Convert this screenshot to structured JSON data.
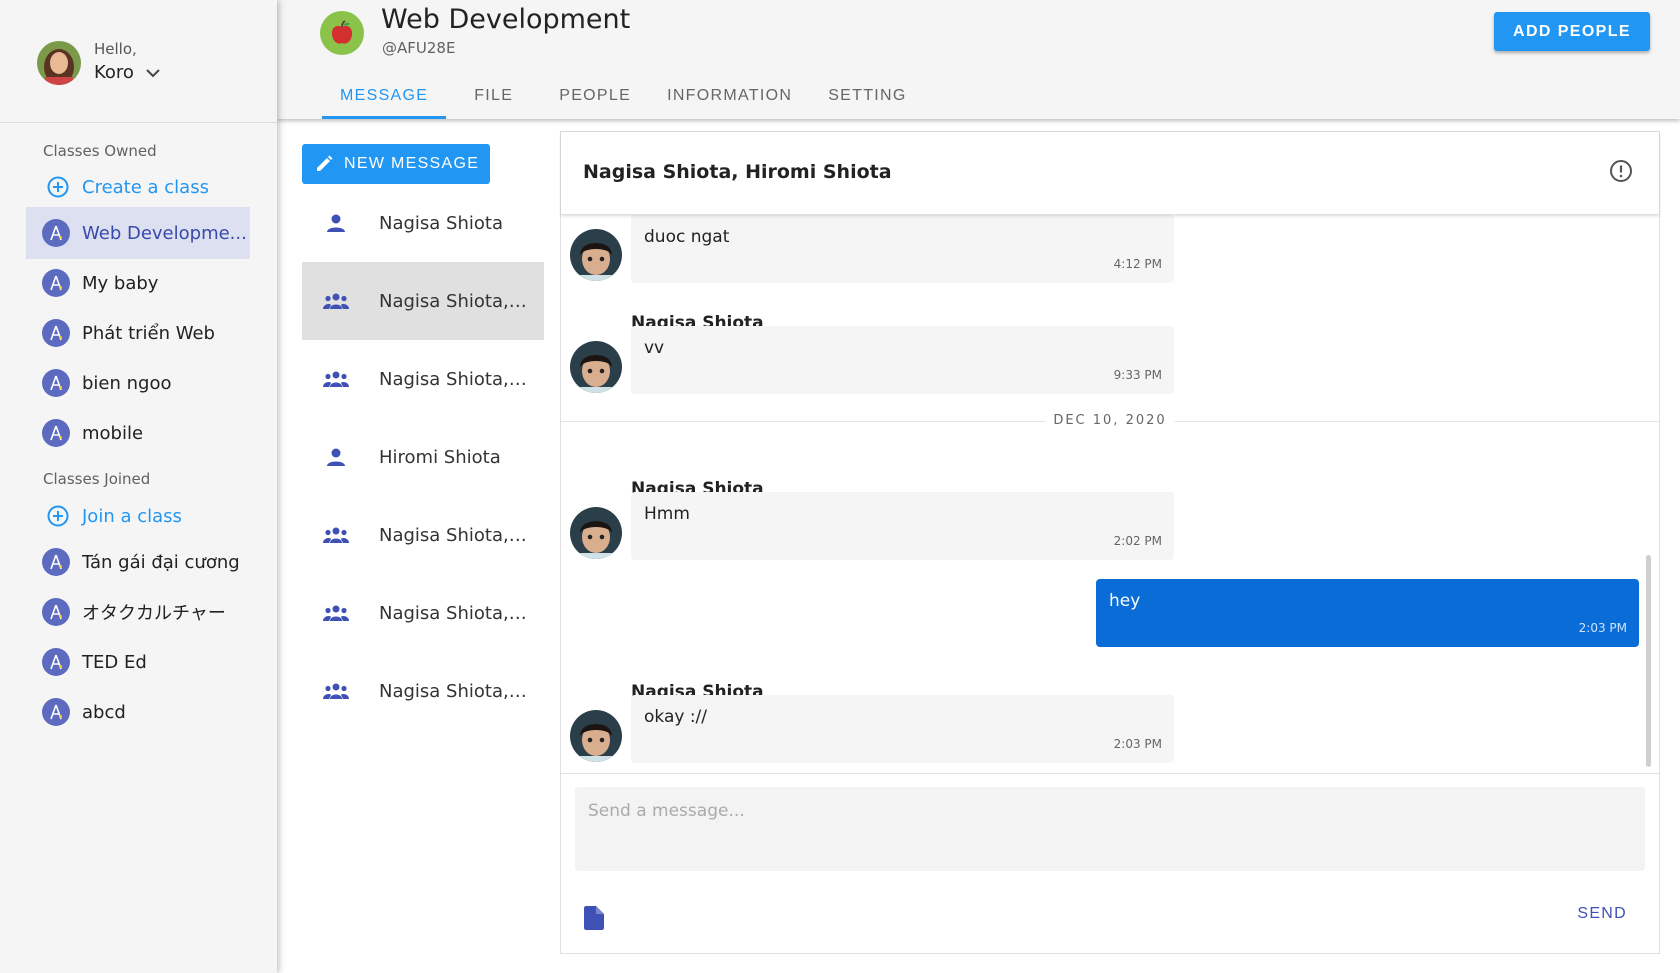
{
  "user": {
    "greeting": "Hello,",
    "name": "Koro"
  },
  "sidebar": {
    "owned_title": "Classes Owned",
    "create_label": "Create a class",
    "owned": [
      {
        "label": "Web Developme..."
      },
      {
        "label": "My baby"
      },
      {
        "label": "Phát triển Web"
      },
      {
        "label": "bien ngoo"
      },
      {
        "label": "mobile"
      }
    ],
    "joined_title": "Classes Joined",
    "join_label": "Join a class",
    "joined": [
      {
        "label": "Tán gái đại cương"
      },
      {
        "label": "オタクカルチャー"
      },
      {
        "label": "TED Ed"
      },
      {
        "label": "abcd"
      }
    ]
  },
  "header": {
    "title": "Web Development",
    "code": "@AFU28E",
    "add_button": "ADD PEOPLE",
    "tabs": [
      {
        "label": "MESSAGE"
      },
      {
        "label": "FILE"
      },
      {
        "label": "PEOPLE"
      },
      {
        "label": "INFORMATION"
      },
      {
        "label": "SETTING"
      }
    ]
  },
  "conversations": {
    "new_button": "NEW MESSAGE",
    "items": [
      {
        "label": "Nagisa Shiota",
        "icon": "person-icon"
      },
      {
        "label": "Nagisa Shiota, ...",
        "icon": "group-icon"
      },
      {
        "label": "Nagisa Shiota, ...",
        "icon": "group-icon"
      },
      {
        "label": "Hiromi Shiota",
        "icon": "person-icon"
      },
      {
        "label": "Nagisa Shiota, ...",
        "icon": "group-icon"
      },
      {
        "label": "Nagisa Shiota, ...",
        "icon": "group-icon"
      },
      {
        "label": "Nagisa Shiota, ...",
        "icon": "group-icon"
      }
    ]
  },
  "chat": {
    "title": "Nagisa Shiota, Hiromi Shiota",
    "messages": [
      {
        "sender": "",
        "text": "duoc ngat",
        "time": "4:12 PM"
      },
      {
        "sender": "Nagisa Shiota",
        "text": "vv",
        "time": "9:33 PM"
      },
      {
        "sender": "Nagisa Shiota",
        "text": "Hmm",
        "time": "2:02 PM"
      },
      {
        "sender": "",
        "text": "hey",
        "time": "2:03 PM"
      },
      {
        "sender": "Nagisa Shiota",
        "text": "okay ://",
        "time": "2:03 PM"
      }
    ],
    "date_separator": "DEC 10, 2020",
    "input_placeholder": "Send a message...",
    "send_label": "SEND"
  },
  "colors": {
    "accent": "#2196f3",
    "own_bubble": "#0a6cd6",
    "class_icon": "#5c6bc0"
  }
}
